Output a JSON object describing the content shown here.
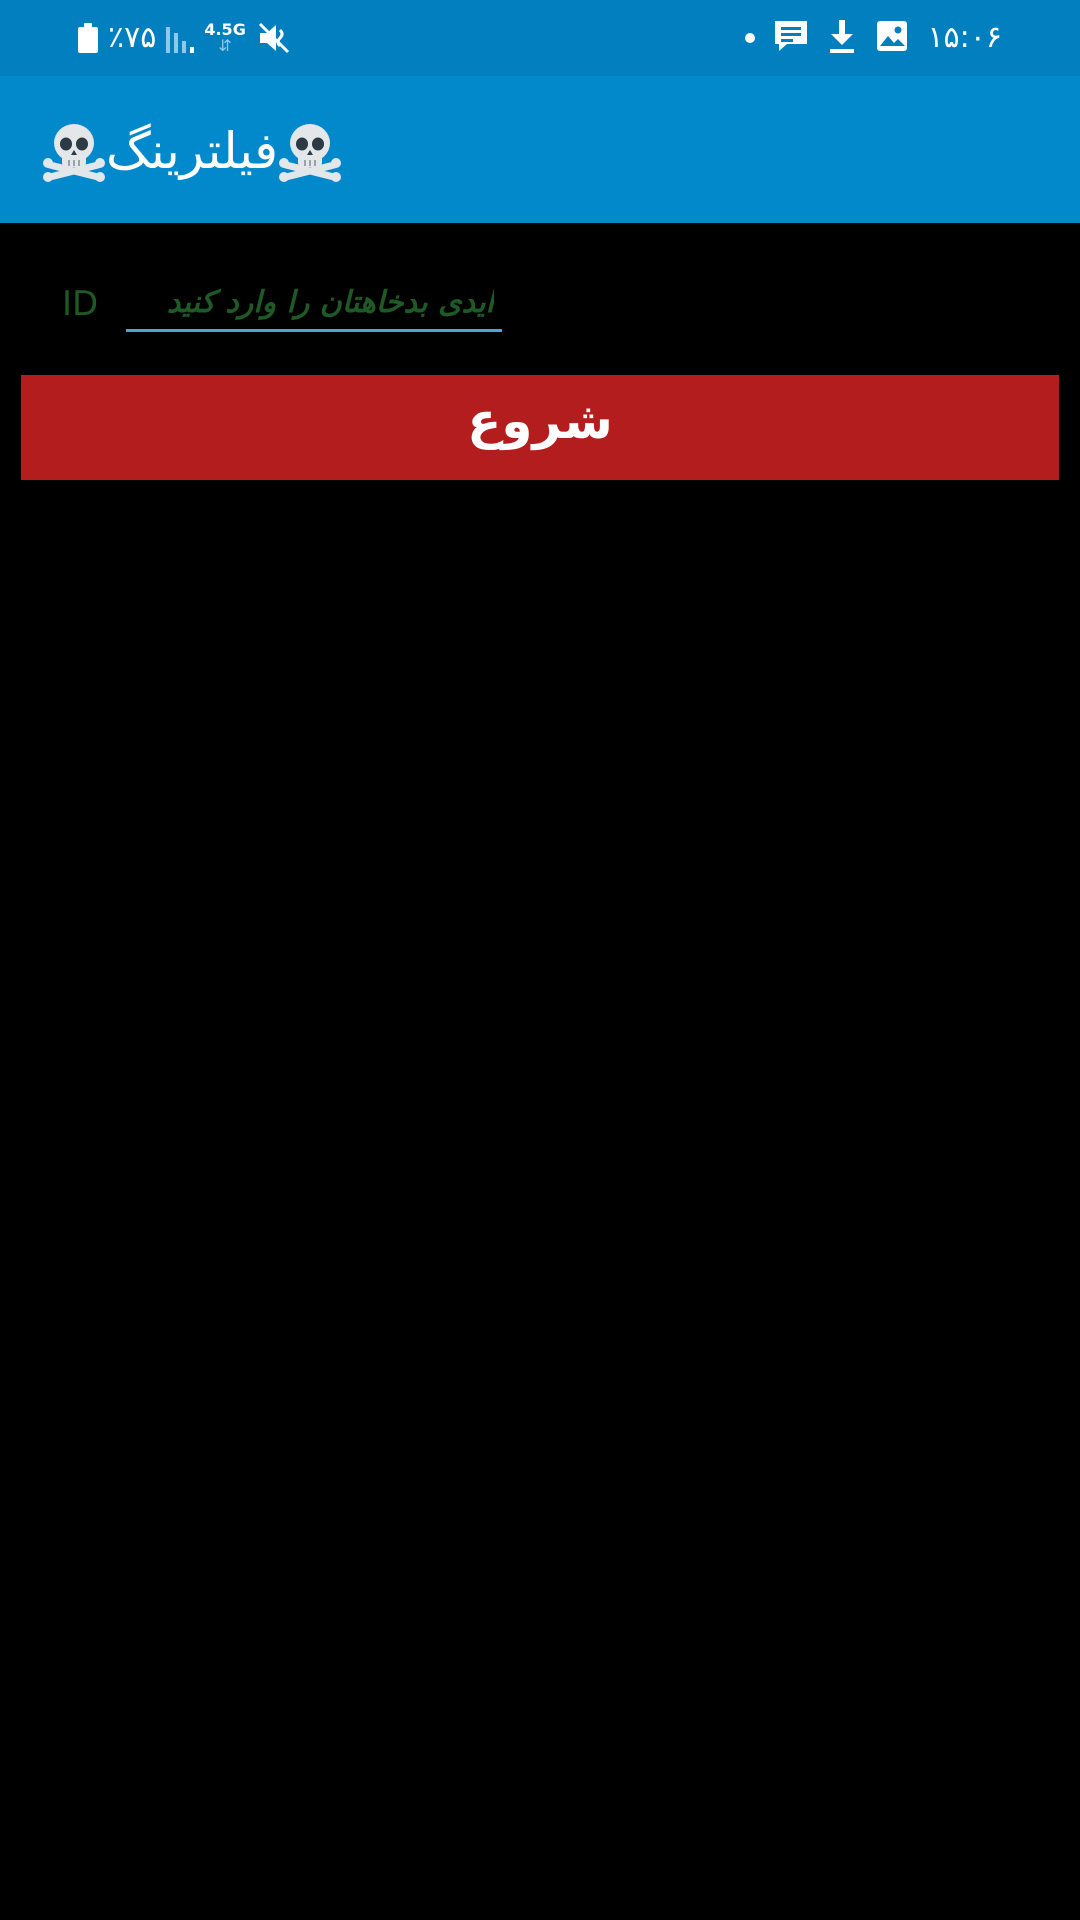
{
  "status_bar": {
    "battery_text": "٪۷۵",
    "network_label": "4.5G",
    "network_arrows": "⇵",
    "time": "۱۵:۰۶",
    "icons": [
      "battery-icon",
      "signal-icon",
      "network-4.5g-icon",
      "mute-icon",
      "dot-icon",
      "message-icon",
      "download-icon",
      "image-icon"
    ]
  },
  "app_bar": {
    "title": "فیلترینگ",
    "title_icons": [
      "skull-crossbones-icon",
      "skull-crossbones-icon"
    ],
    "background": "#0189cb"
  },
  "form": {
    "id_label": "ID",
    "id_placeholder": "ایدی بدخاهتان را وارد کنید",
    "id_value": "",
    "start_label": "شروع",
    "start_color": "#b31d1e"
  }
}
